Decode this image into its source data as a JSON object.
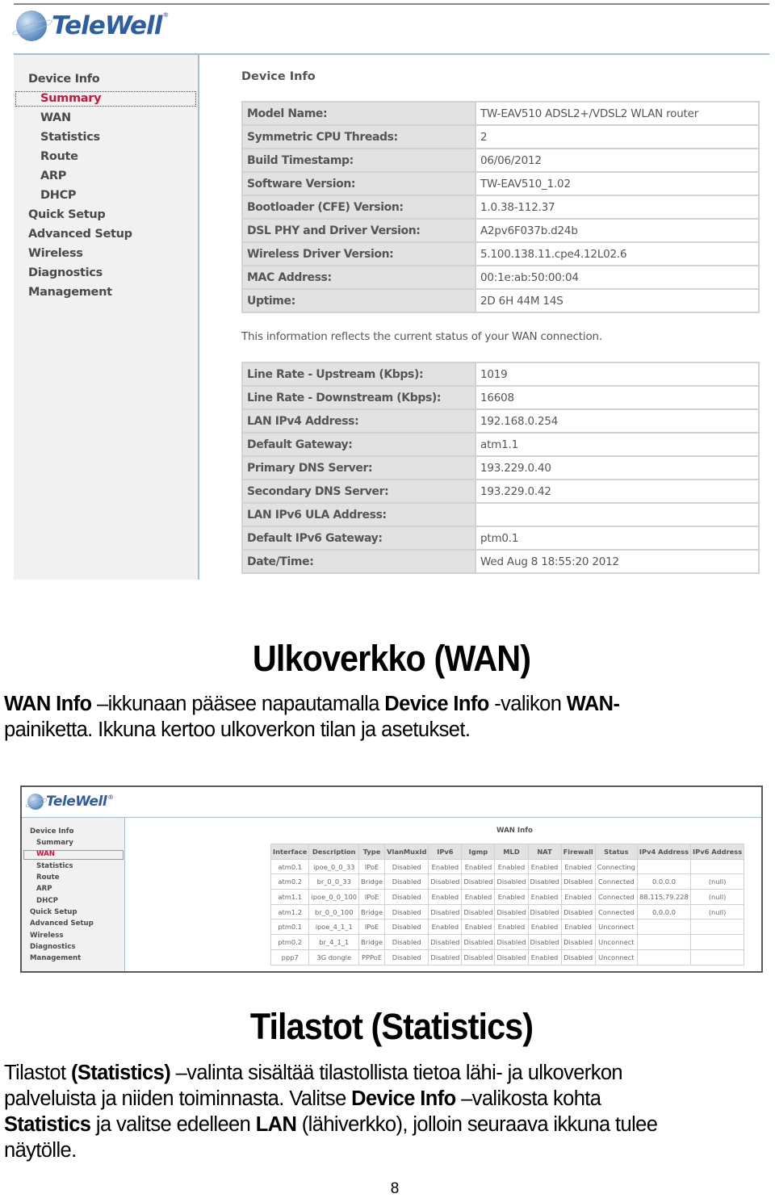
{
  "brand": {
    "name": "TeleWell",
    "registered": "®",
    "accent": "#2d5da2",
    "active_color": "#c21a3e"
  },
  "device_info_screen": {
    "sidebar": {
      "items": [
        {
          "label": "Device Info",
          "level": "top"
        },
        {
          "label": "Summary",
          "level": "sub",
          "active": true
        },
        {
          "label": "WAN",
          "level": "sub"
        },
        {
          "label": "Statistics",
          "level": "sub"
        },
        {
          "label": "Route",
          "level": "sub"
        },
        {
          "label": "ARP",
          "level": "sub"
        },
        {
          "label": "DHCP",
          "level": "sub"
        },
        {
          "label": "Quick Setup",
          "level": "top"
        },
        {
          "label": "Advanced Setup",
          "level": "top"
        },
        {
          "label": "Wireless",
          "level": "top"
        },
        {
          "label": "Diagnostics",
          "level": "top"
        },
        {
          "label": "Management",
          "level": "top"
        }
      ]
    },
    "title": "Device Info",
    "device_table": [
      {
        "label": "Model Name:",
        "value": "TW-EAV510 ADSL2+/VDSL2 WLAN router"
      },
      {
        "label": "Symmetric CPU Threads:",
        "value": "2"
      },
      {
        "label": "Build Timestamp:",
        "value": "06/06/2012"
      },
      {
        "label": "Software Version:",
        "value": "TW-EAV510_1.02"
      },
      {
        "label": "Bootloader (CFE) Version:",
        "value": "1.0.38-112.37"
      },
      {
        "label": "DSL PHY and Driver Version:",
        "value": "A2pv6F037b.d24b"
      },
      {
        "label": "Wireless Driver Version:",
        "value": "5.100.138.11.cpe4.12L02.6"
      },
      {
        "label": "MAC Address:",
        "value": "00:1e:ab:50:00:04"
      },
      {
        "label": "Uptime:",
        "value": "2D 6H 44M 14S"
      }
    ],
    "note": "This information reflects the current status of your WAN connection.",
    "wan_status_table": [
      {
        "label": "Line Rate - Upstream (Kbps):",
        "value": "1019"
      },
      {
        "label": "Line Rate - Downstream (Kbps):",
        "value": "16608"
      },
      {
        "label": "LAN IPv4 Address:",
        "value": "192.168.0.254"
      },
      {
        "label": "Default Gateway:",
        "value": "atm1.1"
      },
      {
        "label": "Primary DNS Server:",
        "value": "193.229.0.40"
      },
      {
        "label": "Secondary DNS Server:",
        "value": "193.229.0.42"
      },
      {
        "label": "LAN IPv6 ULA Address:",
        "value": ""
      },
      {
        "label": "Default IPv6 Gateway:",
        "value": "ptm0.1"
      },
      {
        "label": "Date/Time:",
        "value": "Wed Aug 8 18:55:20 2012"
      }
    ]
  },
  "section_wan": {
    "heading": "Ulkoverkko (WAN)",
    "line1": [
      {
        "text": "WAN Info",
        "bold": true
      },
      {
        "text": " –ikkunaan pääsee napautamalla ",
        "bold": false
      },
      {
        "text": "Device Info",
        "bold": true
      },
      {
        "text": " -valikon ",
        "bold": false
      },
      {
        "text": "WAN-",
        "bold": true
      }
    ],
    "line2": "painiketta. Ikkuna kertoo ulkoverkon tilan ja asetukset."
  },
  "wan_info_screen": {
    "sidebar": {
      "items": [
        {
          "label": "Device Info",
          "level": "top"
        },
        {
          "label": "Summary",
          "level": "sub"
        },
        {
          "label": "WAN",
          "level": "sub",
          "active": true
        },
        {
          "label": "Statistics",
          "level": "sub"
        },
        {
          "label": "Route",
          "level": "sub"
        },
        {
          "label": "ARP",
          "level": "sub"
        },
        {
          "label": "DHCP",
          "level": "sub"
        },
        {
          "label": "Quick Setup",
          "level": "top"
        },
        {
          "label": "Advanced Setup",
          "level": "top"
        },
        {
          "label": "Wireless",
          "level": "top"
        },
        {
          "label": "Diagnostics",
          "level": "top"
        },
        {
          "label": "Management",
          "level": "top"
        }
      ]
    },
    "title": "WAN Info",
    "columns": [
      "Interface",
      "Description",
      "Type",
      "VlanMuxId",
      "IPv6",
      "Igmp",
      "MLD",
      "NAT",
      "Firewall",
      "Status",
      "IPv4 Address",
      "IPv6 Address"
    ],
    "rows": [
      [
        "atm0.1",
        "ipoe_0_0_33",
        "IPoE",
        "Disabled",
        "Enabled",
        "Enabled",
        "Enabled",
        "Enabled",
        "Enabled",
        "Connecting",
        "",
        ""
      ],
      [
        "atm0.2",
        "br_0_0_33",
        "Bridge",
        "Disabled",
        "Disabled",
        "Disabled",
        "Disabled",
        "Disabled",
        "Disabled",
        "Connected",
        "0.0.0.0",
        "(null)"
      ],
      [
        "atm1.1",
        "ipoe_0_0_100",
        "IPoE",
        "Disabled",
        "Enabled",
        "Enabled",
        "Enabled",
        "Enabled",
        "Enabled",
        "Connected",
        "88.115.79.228",
        "(null)"
      ],
      [
        "atm1.2",
        "br_0_0_100",
        "Bridge",
        "Disabled",
        "Disabled",
        "Disabled",
        "Disabled",
        "Disabled",
        "Disabled",
        "Connected",
        "0.0.0.0",
        "(null)"
      ],
      [
        "ptm0.1",
        "ipoe_4_1_1",
        "IPoE",
        "Disabled",
        "Enabled",
        "Enabled",
        "Enabled",
        "Enabled",
        "Enabled",
        "Unconnect",
        "",
        ""
      ],
      [
        "ptm0.2",
        "br_4_1_1",
        "Bridge",
        "Disabled",
        "Disabled",
        "Disabled",
        "Disabled",
        "Disabled",
        "Disabled",
        "Unconnect",
        "",
        ""
      ],
      [
        "ppp7",
        "3G dongle",
        "PPPoE",
        "Disabled",
        "Disabled",
        "Disabled",
        "Disabled",
        "Enabled",
        "Disabled",
        "Unconnect",
        "",
        ""
      ]
    ]
  },
  "section_statistics": {
    "heading": "Tilastot (Statistics)",
    "lines": [
      [
        {
          "text": "Tilastot ",
          "bold": false
        },
        {
          "text": "(Statistics)",
          "bold": true
        },
        {
          "text": " –valinta sisältää tilastollista tietoa lähi- ja ulkoverkon",
          "bold": false
        }
      ],
      [
        {
          "text": "palveluista ja niiden toiminnasta. Valitse ",
          "bold": false
        },
        {
          "text": "Device Info",
          "bold": true
        },
        {
          "text": " –valikosta kohta",
          "bold": false
        }
      ],
      [
        {
          "text": "Statistics",
          "bold": true
        },
        {
          "text": " ja valitse edelleen ",
          "bold": false
        },
        {
          "text": "LAN",
          "bold": true
        },
        {
          "text": " (lähiverkko), jolloin seuraava ikkuna tulee",
          "bold": false
        }
      ],
      [
        {
          "text": "näytölle.",
          "bold": false
        }
      ]
    ]
  },
  "page_number": "8"
}
